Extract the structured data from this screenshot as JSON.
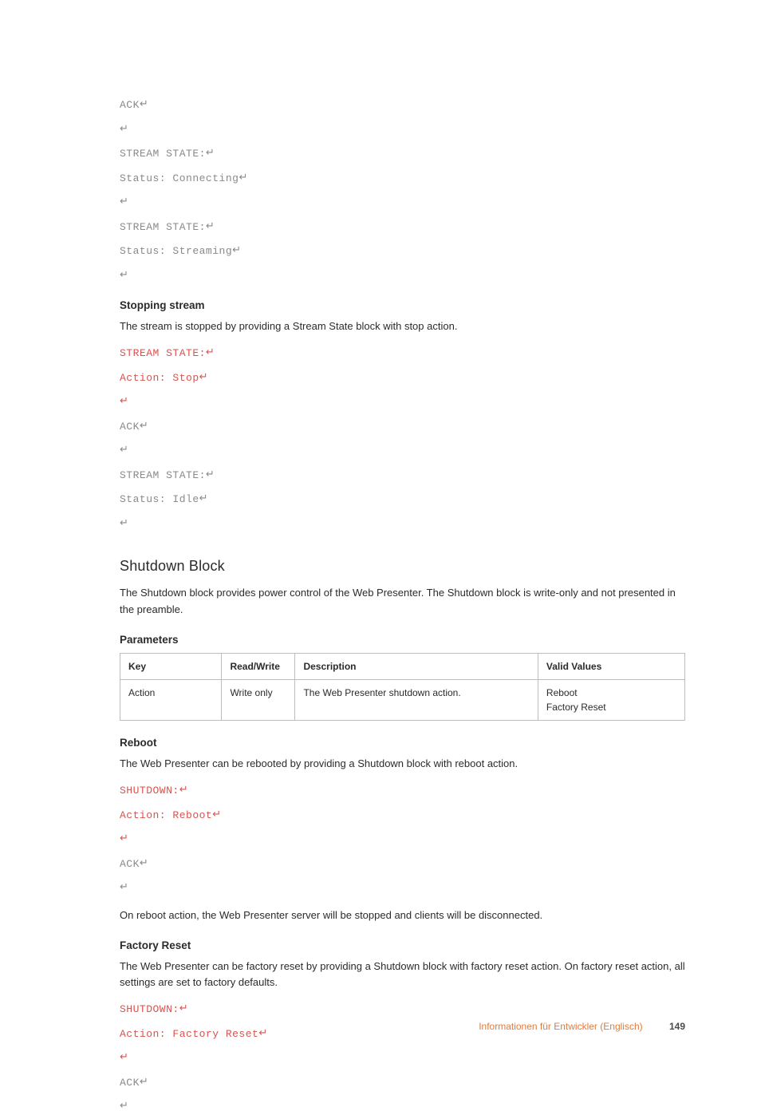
{
  "code1": {
    "l1": "ACK",
    "l2": "STREAM STATE:",
    "l3": "Status: Connecting",
    "l4": "STREAM STATE:",
    "l5": "Status: Streaming"
  },
  "stopping": {
    "heading": "Stopping stream",
    "text": "The stream is stopped by providing a Stream State block with stop action.",
    "code": {
      "l1": "STREAM STATE:",
      "l2": "Action: Stop",
      "l3": "ACK",
      "l4": "STREAM STATE:",
      "l5": "Status: Idle"
    }
  },
  "shutdown": {
    "heading": "Shutdown Block",
    "text": "The Shutdown block provides power control of the Web Presenter. The Shutdown block is write-only and not presented in the preamble."
  },
  "params": {
    "heading": "Parameters",
    "headers": {
      "key": "Key",
      "rw": "Read/Write",
      "desc": "Description",
      "valid": "Valid Values"
    },
    "row": {
      "key": "Action",
      "rw": "Write only",
      "desc": "The Web Presenter shutdown action.",
      "valid1": "Reboot",
      "valid2": "Factory Reset"
    }
  },
  "reboot": {
    "heading": "Reboot",
    "text": "The Web Presenter can be rebooted by providing a Shutdown block with reboot action.",
    "code": {
      "l1": "SHUTDOWN:",
      "l2": "Action: Reboot",
      "l3": "ACK"
    },
    "after": "On reboot action, the Web Presenter server will be stopped and clients will be disconnected."
  },
  "factory": {
    "heading": "Factory Reset",
    "text": "The Web Presenter can be factory reset by providing a Shutdown block with factory reset action. On factory reset action, all settings are set to factory defaults.",
    "code": {
      "l1": "SHUTDOWN:",
      "l2": "Action: Factory Reset",
      "l3": "ACK"
    }
  },
  "footer": {
    "text": "Informationen für Entwickler (Englisch)",
    "page": "149"
  }
}
